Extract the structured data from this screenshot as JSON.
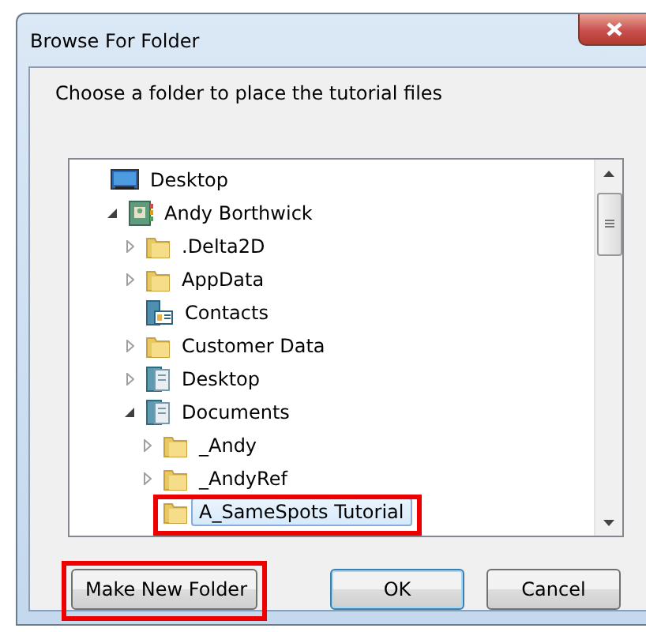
{
  "window": {
    "title": "Browse For Folder"
  },
  "prompt": "Choose a folder to place the tutorial files",
  "tree": [
    {
      "label": "Desktop",
      "kind": "desktop",
      "selected": false,
      "highlighted": false,
      "children": [
        {
          "label": "Andy Borthwick",
          "kind": "user",
          "expanded": true,
          "selected": false,
          "highlighted": false,
          "children": [
            {
              "label": ".Delta2D",
              "kind": "folder",
              "expanded": false,
              "selected": false,
              "highlighted": false
            },
            {
              "label": "AppData",
              "kind": "folder",
              "expanded": false,
              "selected": false,
              "highlighted": false
            },
            {
              "label": "Contacts",
              "kind": "contacts",
              "selected": false,
              "highlighted": false
            },
            {
              "label": "Customer Data",
              "kind": "folder",
              "expanded": false,
              "selected": false,
              "highlighted": false
            },
            {
              "label": "Desktop",
              "kind": "library",
              "expanded": false,
              "selected": false,
              "highlighted": false
            },
            {
              "label": "Documents",
              "kind": "library",
              "expanded": true,
              "selected": false,
              "highlighted": false,
              "children": [
                {
                  "label": "_Andy",
                  "kind": "folder",
                  "expanded": false,
                  "selected": false,
                  "highlighted": false
                },
                {
                  "label": "_AndyRef",
                  "kind": "folder",
                  "expanded": false,
                  "selected": false,
                  "highlighted": false
                },
                {
                  "label": "A_SameSpots Tutorial",
                  "kind": "folder",
                  "selected": true,
                  "highlighted": true
                }
              ]
            }
          ]
        }
      ]
    }
  ],
  "buttons": [
    {
      "label": "Make New Folder",
      "kind": "left",
      "default": false,
      "highlighted": true
    },
    {
      "label": "OK",
      "kind": "right",
      "default": true,
      "highlighted": false
    },
    {
      "label": "Cancel",
      "kind": "right",
      "default": false,
      "highlighted": false
    }
  ]
}
